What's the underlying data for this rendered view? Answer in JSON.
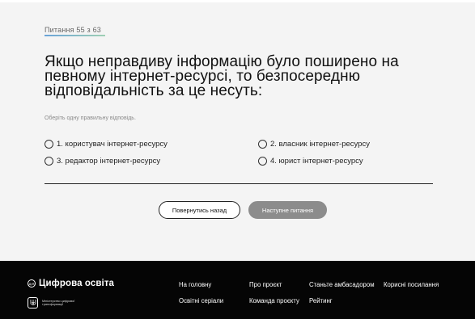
{
  "quiz": {
    "counter": "Питання 55 з 63",
    "question": "Якщо неправдиву інформацію було поширено на певному інтернет-ресурсі, то безпосередню відповідальність за це несуть:",
    "hint": "Оберіть одну правильну відповідь.",
    "options": [
      {
        "label": "1. користувач інтернет-ресурсу"
      },
      {
        "label": "2. власник інтернет-ресурсу"
      },
      {
        "label": "3. редактор інтернет-ресурсу"
      },
      {
        "label": "4. юрист інтернет-ресурсу"
      }
    ],
    "back_label": "Повернутись назад",
    "next_label": "Наступне питання"
  },
  "footer": {
    "brand_name": "Цифрова освіта",
    "brand_icon_text": "ДІЯ",
    "ministry_text": "Міністерство цифрової трансформації",
    "links": [
      {
        "label": "На головну"
      },
      {
        "label": "Про проєкт"
      },
      {
        "label": "Станьте амбасадором"
      },
      {
        "label": "Корисні посилання"
      },
      {
        "label": "Освітні серіали"
      },
      {
        "label": "Команда проєкту"
      },
      {
        "label": "Рейтинг"
      }
    ]
  },
  "colors": {
    "background": "#f4f4f4",
    "footer": "#050505",
    "next_button": "#8c8c8c"
  }
}
